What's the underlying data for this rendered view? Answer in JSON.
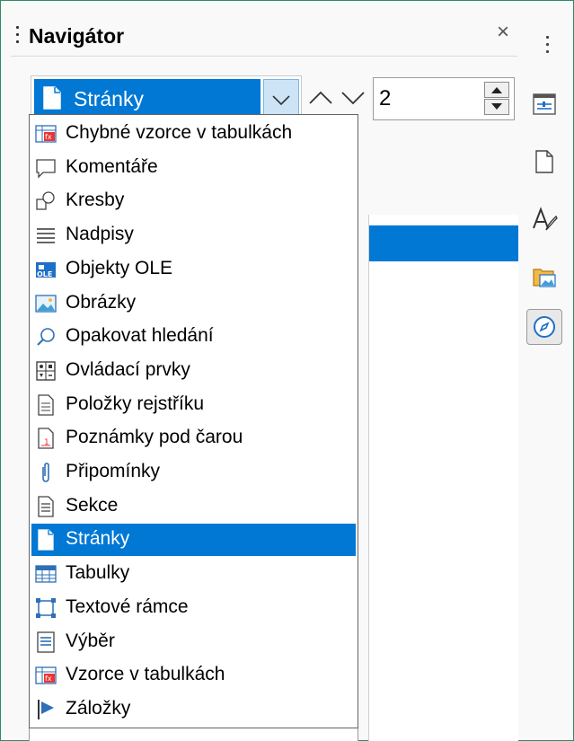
{
  "deck": {
    "title": "Navigátor",
    "close_glyph": "×"
  },
  "toolbar": {
    "content_type": {
      "selected": "Stránky",
      "icon": "page-icon"
    },
    "prev_glyph": "previous-arrow-icon",
    "next_glyph": "next-arrow-icon",
    "page_value": "2"
  },
  "dropdown": {
    "items": [
      {
        "label": "Chybné vzorce v tabulkách",
        "icon": "fx-table-icon"
      },
      {
        "label": "Komentáře",
        "icon": "speech-bubble-icon"
      },
      {
        "label": "Kresby",
        "icon": "shapes-icon"
      },
      {
        "label": "Nadpisy",
        "icon": "headings-icon"
      },
      {
        "label": "Objekty OLE",
        "icon": "ole-icon"
      },
      {
        "label": "Obrázky",
        "icon": "image-icon"
      },
      {
        "label": "Opakovat hledání",
        "icon": "magnifier-icon"
      },
      {
        "label": "Ovládací prvky",
        "icon": "controls-icon"
      },
      {
        "label": "Položky rejstříku",
        "icon": "index-entry-icon"
      },
      {
        "label": "Poznámky pod čarou",
        "icon": "footnote-icon"
      },
      {
        "label": "Připomínky",
        "icon": "paperclip-icon"
      },
      {
        "label": "Sekce",
        "icon": "section-icon"
      },
      {
        "label": "Stránky",
        "icon": "page-icon",
        "selected": true
      },
      {
        "label": "Tabulky",
        "icon": "table-icon"
      },
      {
        "label": "Textové rámce",
        "icon": "frame-icon"
      },
      {
        "label": "Výběr",
        "icon": "selection-icon"
      },
      {
        "label": "Vzorce v tabulkách",
        "icon": "fx-table-icon"
      },
      {
        "label": "Záložky",
        "icon": "bookmark-flag-icon"
      }
    ]
  },
  "sidebar_tabs": [
    {
      "name": "properties-tab",
      "icon": "properties-icon"
    },
    {
      "name": "page-tab",
      "icon": "page-icon"
    },
    {
      "name": "styles-tab",
      "icon": "styles-icon"
    },
    {
      "name": "gallery-tab",
      "icon": "gallery-icon"
    },
    {
      "name": "navigator-tab",
      "icon": "compass-icon",
      "active": true
    }
  ],
  "colors": {
    "accent": "#0078d4",
    "frame_border": "#2f8a63"
  }
}
